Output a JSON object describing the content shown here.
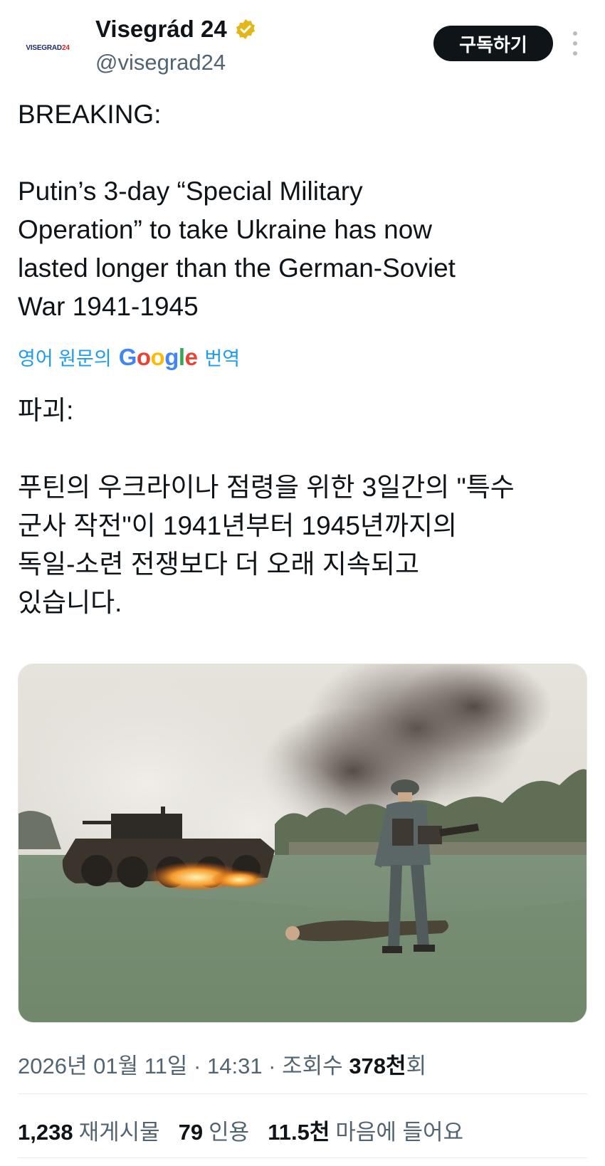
{
  "account": {
    "avatar_text_main": "VISEGRAD",
    "avatar_text_accent": "24",
    "display_name": "Visegrád 24",
    "handle": "@visegrad24",
    "verified_color": "#e2b719"
  },
  "actions": {
    "subscribe_label": "구독하기",
    "more_icon": "more-vertical-icon"
  },
  "tweet": {
    "paragraphs": [
      "BREAKING:",
      "",
      "Putin’s 3-day “Special Military\nOperation” to take Ukraine has now\nlasted longer than the German-Soviet\nWar 1941-1945"
    ]
  },
  "translation": {
    "prefix": "영어 원문의",
    "logo_letters": [
      "G",
      "o",
      "o",
      "g",
      "l",
      "e"
    ],
    "suffix": "번역",
    "paragraphs": [
      "파괴:",
      "",
      "푸틴의 우크라이나 점령을 위한 3일간의 \"특수\n군사 작전\"이 1941년부터 1945년까지의\n독일-소련 전쟁보다 더 오래 지속되고\n있습니다."
    ]
  },
  "meta": {
    "date": "2026년 01월 11일",
    "sep1": " · ",
    "time": "14:31",
    "sep2": " · ",
    "views_label": "조회수 ",
    "views_value": "378천",
    "views_suffix": "회"
  },
  "stats": [
    {
      "value": "1,238",
      "label": "재게시물"
    },
    {
      "value": "79",
      "label": "인용"
    },
    {
      "value": "11.5천",
      "label": "마음에 들어요"
    }
  ]
}
